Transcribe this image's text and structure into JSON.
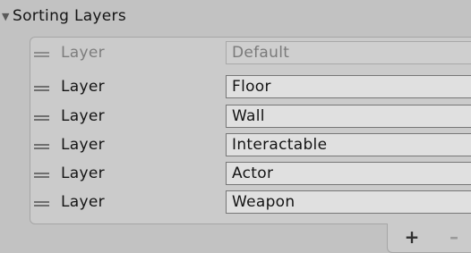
{
  "section": {
    "title": "Sorting Layers",
    "expanded": true
  },
  "layers": [
    {
      "label": "Layer",
      "value": "Default",
      "enabled": false
    },
    {
      "label": "Layer",
      "value": "Floor",
      "enabled": true
    },
    {
      "label": "Layer",
      "value": "Wall",
      "enabled": true
    },
    {
      "label": "Layer",
      "value": "Interactable",
      "enabled": true
    },
    {
      "label": "Layer",
      "value": "Actor",
      "enabled": true
    },
    {
      "label": "Layer",
      "value": "Weapon",
      "enabled": true
    }
  ],
  "footer": {
    "add_label": "+",
    "remove_label": "–"
  }
}
